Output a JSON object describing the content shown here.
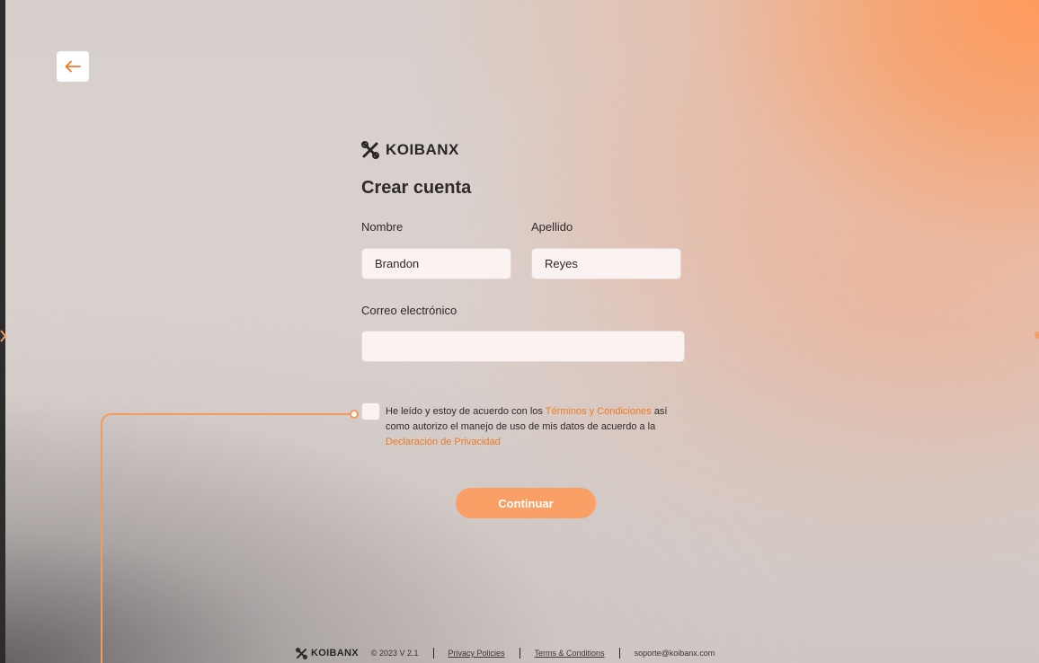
{
  "brand": {
    "name": "KOIBANX"
  },
  "form": {
    "title": "Crear cuenta",
    "first_name": {
      "label": "Nombre",
      "value": "Brandon"
    },
    "last_name": {
      "label": "Apellido",
      "value": "Reyes"
    },
    "email": {
      "label": "Correo electrónico",
      "value": ""
    },
    "terms": {
      "text_before": "He leído y estoy de acuerdo con los",
      "terms_link": "Términos y Condiciones",
      "text_middle": "así  como autorizo el manejo de uso de mis datos de acuerdo a la",
      "privacy_link": "Declaración de Privacidad",
      "checked": false
    },
    "continue_label": "Continuar"
  },
  "footer": {
    "brand": "KOIBANX",
    "copyright": "© 2023  V 2.1",
    "privacy": "Privacy Policies",
    "terms": "Terms & Conditions",
    "email": "soporte@koibanx.com"
  },
  "colors": {
    "accent": "#f07a22",
    "button": "#f8a065",
    "decor_line": "#f59a5e"
  },
  "icons": {
    "back": "arrow-left-icon",
    "logo": "koibanx-logo-icon"
  }
}
